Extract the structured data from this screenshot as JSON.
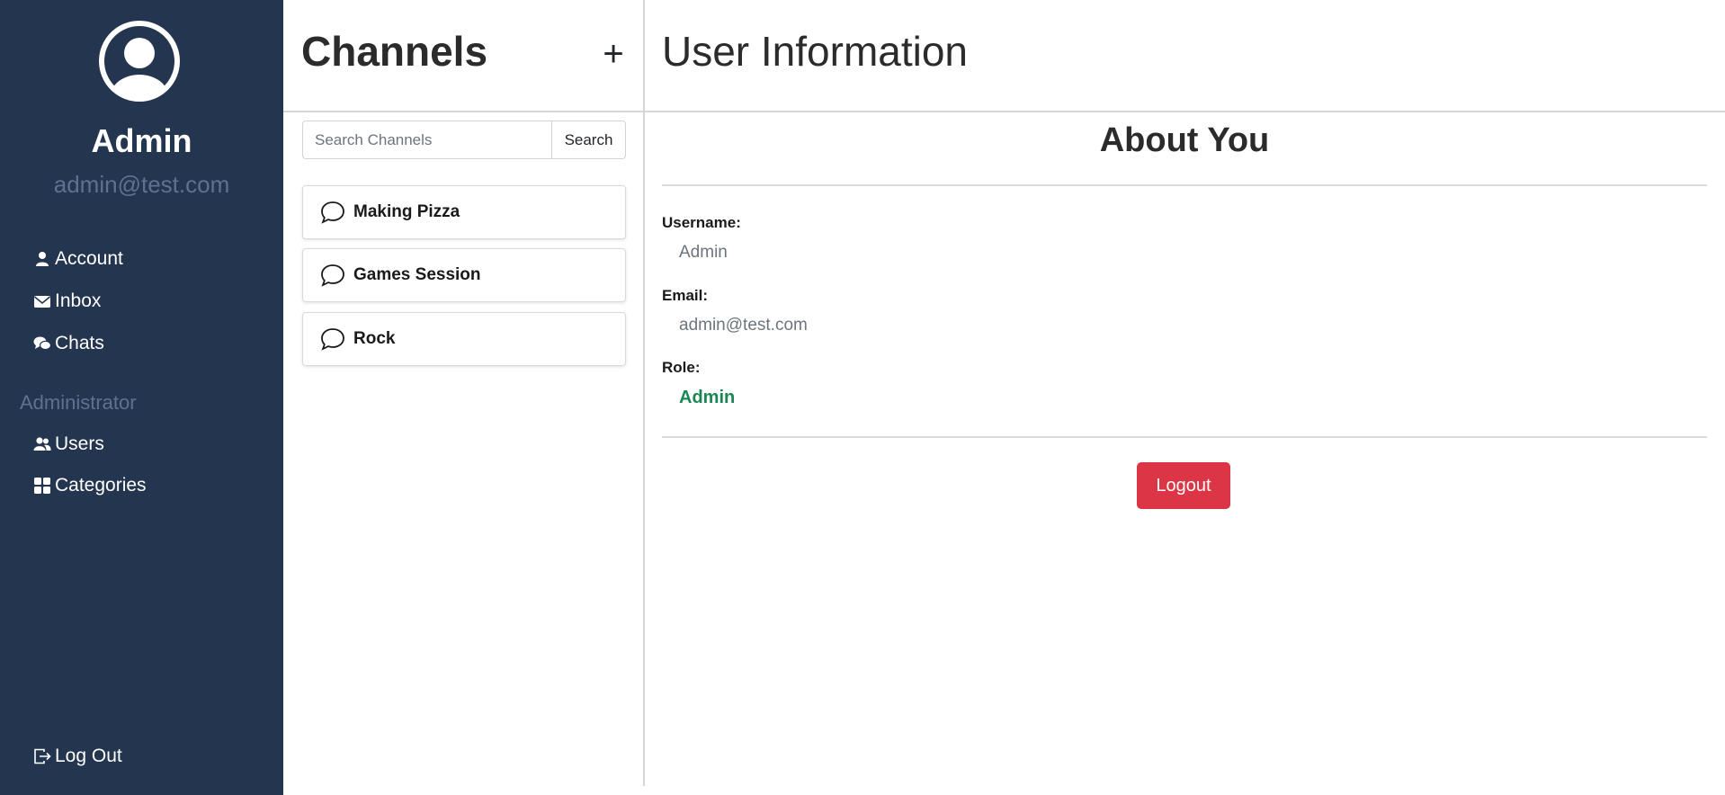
{
  "sidebar": {
    "user_name": "Admin",
    "user_email": "admin@test.com",
    "nav": [
      {
        "label": "Account",
        "icon": "person-icon"
      },
      {
        "label": "Inbox",
        "icon": "envelope-icon"
      },
      {
        "label": "Chats",
        "icon": "chat-bubbles-icon"
      }
    ],
    "admin_section_title": "Administrator",
    "admin_nav": [
      {
        "label": "Users",
        "icon": "people-icon"
      },
      {
        "label": "Categories",
        "icon": "grid-icon"
      }
    ],
    "logout_label": "Log Out"
  },
  "channels": {
    "title": "Channels",
    "add_icon": "plus-icon",
    "search_placeholder": "Search Channels",
    "search_button": "Search",
    "items": [
      {
        "label": "Making Pizza"
      },
      {
        "label": "Games Session"
      },
      {
        "label": "Rock"
      }
    ]
  },
  "user_info": {
    "title": "User Information",
    "section_title": "About You",
    "username_label": "Username:",
    "username_value": "Admin",
    "email_label": "Email:",
    "email_value": "admin@test.com",
    "role_label": "Role:",
    "role_value": "Admin",
    "logout_button": "Logout"
  },
  "colors": {
    "sidebar_bg": "#243550",
    "muted_sidebar_text": "#5f7190",
    "role_color": "#198754",
    "logout_bg": "#dc3545"
  }
}
